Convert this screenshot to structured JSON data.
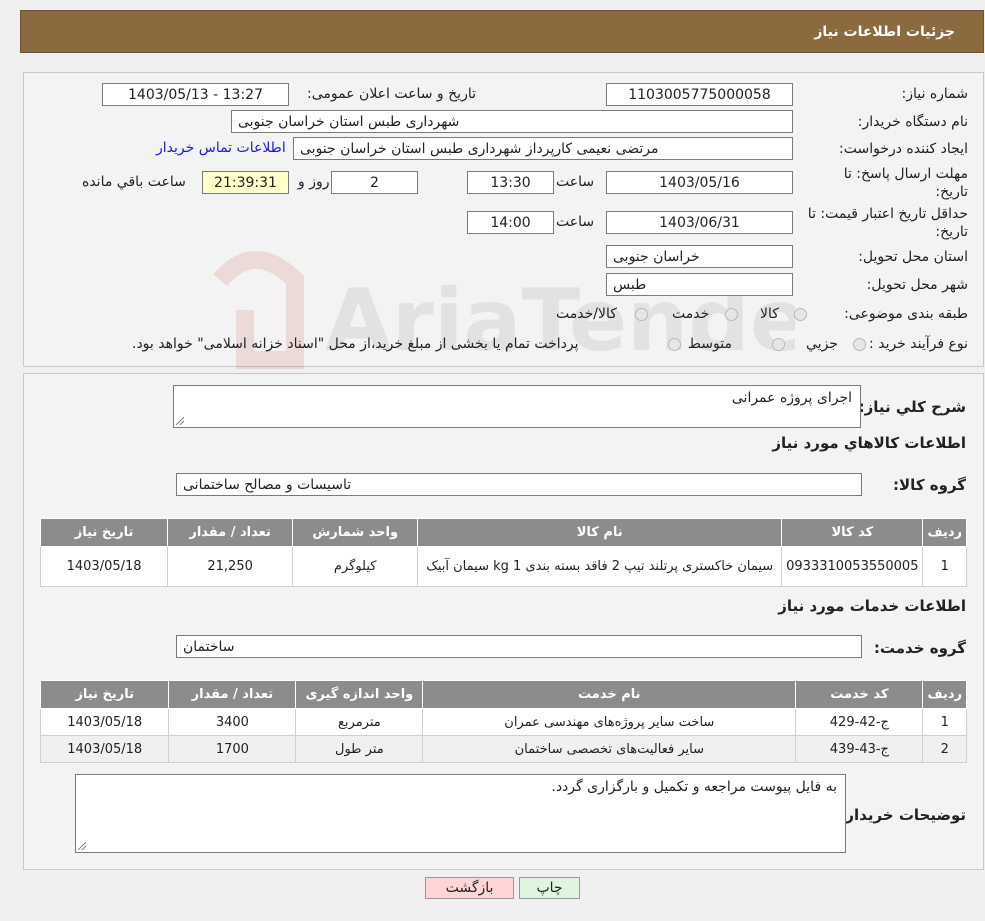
{
  "header": {
    "title": "جزئیات اطلاعات نیاز"
  },
  "form": {
    "need_number_label": "شماره نیاز:",
    "need_number": "1103005775000058",
    "announce_label": "تاریخ و ساعت اعلان عمومی:",
    "announce_value": "1403/05/13 - 13:27",
    "buyer_org_label": "نام دستگاه خریدار:",
    "buyer_org": "شهرداری طبس استان خراسان جنوبی",
    "creator_label": "ایجاد کننده درخواست:",
    "creator": "مرتضی نعیمی کارپرداز شهرداری طبس استان خراسان جنوبی",
    "contact_link": "اطلاعات تماس خریدار",
    "deadline_label_1": "مهلت ارسال پاسخ: تا",
    "deadline_label_2": "تاریخ:",
    "deadline_date": "1403/05/16",
    "time_label": "ساعت",
    "deadline_time": "13:30",
    "days_value": "2",
    "days_label": "روز و",
    "remaining_time": "21:39:31",
    "remaining_label": "ساعت باقي مانده",
    "validity_label_1": "حداقل تاریخ اعتبار قیمت: تا",
    "validity_label_2": "تاریخ:",
    "validity_date": "1403/06/31",
    "validity_time": "14:00",
    "province_label": "استان محل تحویل:",
    "province": "خراسان جنوبی",
    "city_label": "شهر محل تحویل:",
    "city": "طبس",
    "category_label": "طبقه بندی موضوعی:",
    "category_options": [
      "کالا",
      "خدمت",
      "کالا/خدمت"
    ],
    "process_label": "نوع فرآیند خرید :",
    "process_options": [
      "جزیي",
      "متوسط"
    ],
    "process_note": "پرداخت تمام یا بخشی از مبلغ خرید،از محل \"اسناد خزانه اسلامی\" خواهد بود."
  },
  "description": {
    "label": "شرح کلي نياز:",
    "value": "اجرای پروژه عمرانی"
  },
  "goods": {
    "section_title": "اطلاعات کالاهاي مورد نياز",
    "group_label": "گروه کالا:",
    "group_value": "تاسیسات و مصالح ساختمانی",
    "columns": [
      "رديف",
      "کد کالا",
      "نام کالا",
      "واحد شمارش",
      "تعداد / مقدار",
      "تاریخ نیاز"
    ],
    "rows": [
      [
        "1",
        "0933310053550005",
        "سیمان خاکستری پرتلند تیپ 2 فاقد بسته بندی 1 kg سیمان آبیک",
        "کیلوگرم",
        "21,250",
        "1403/05/18"
      ]
    ]
  },
  "services": {
    "section_title": "اطلاعات خدمات مورد نياز",
    "group_label": "گروه خدمت:",
    "group_value": "ساختمان",
    "columns": [
      "رديف",
      "کد خدمت",
      "نام خدمت",
      "واحد اندازه گیری",
      "تعداد / مقدار",
      "تاریخ نیاز"
    ],
    "rows": [
      [
        "1",
        "ج-42-429",
        "ساخت سایر پروژه‌های مهندسی عمران",
        "مترمربع",
        "3400",
        "1403/05/18"
      ],
      [
        "2",
        "ج-43-439",
        "سایر فعالیت‌های تخصصی ساختمان",
        "متر طول",
        "1700",
        "1403/05/18"
      ]
    ]
  },
  "buyer_notes": {
    "label": "توضیحات خریدار:",
    "value": "به فایل پیوست مراجعه و تکمیل و بارگزاری گردد."
  },
  "buttons": {
    "print": "چاپ",
    "back": "بازگشت"
  },
  "watermark": {
    "text": "AriaTender.neT"
  },
  "colors": {
    "header": "#8a6a3e",
    "table_header": "#8c8c8c",
    "back_button": "#ffd5d5",
    "print_button": "#dff5df"
  }
}
